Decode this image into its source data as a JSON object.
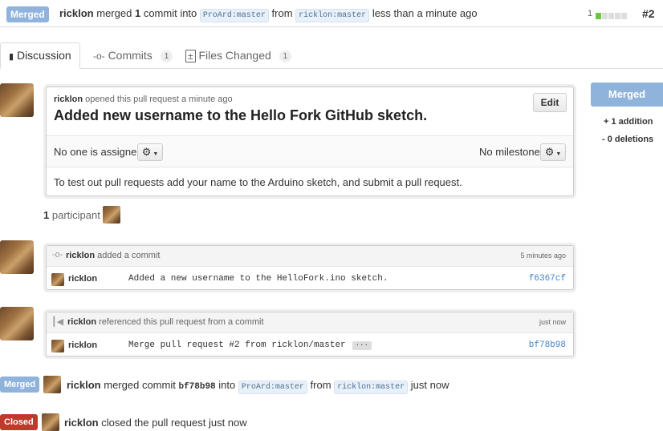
{
  "header": {
    "state": "Merged",
    "user": "ricklon",
    "merged_text": "merged",
    "commit_count": "1",
    "commit_suffix": "commit into",
    "base_ref": "ProArd:master",
    "from": "from",
    "head_ref": "ricklon:master",
    "time": "less than a minute ago",
    "diff_count": "1",
    "pr_number": "#2"
  },
  "tabs": [
    {
      "label": "Discussion"
    },
    {
      "label": "Commits",
      "count": "1"
    },
    {
      "label": "Files Changed",
      "count": "1"
    }
  ],
  "pr": {
    "author": "ricklon",
    "opened": "opened this pull request a minute ago",
    "title": "Added new username to the Hello Fork GitHub sketch.",
    "edit": "Edit",
    "assignee": "No one is assigned",
    "milestone": "No milestone",
    "body": "To test out pull requests add your name to the Arduino sketch, and submit a pull request."
  },
  "sidebar": {
    "state": "Merged",
    "additions": "+ 1 addition",
    "deletions": "- 0 deletions"
  },
  "participants": {
    "count": "1",
    "label": "participant"
  },
  "commit_event": {
    "user": "ricklon",
    "action": "added a commit",
    "time": "5 minutes ago",
    "message": "Added a new username to the HelloFork.ino sketch.",
    "sha": "f6367cf"
  },
  "ref_event": {
    "user": "ricklon",
    "action": "referenced this pull request from a commit",
    "time": "just now",
    "message": "Merge pull request #2 from ricklon/master",
    "dots": "···",
    "sha": "bf78b98"
  },
  "merge_event": {
    "state": "Merged",
    "user": "ricklon",
    "action": "merged commit",
    "sha": "bf78b98",
    "into": "into",
    "base_ref": "ProArd:master",
    "from": "from",
    "head_ref": "ricklon:master",
    "time": "just now"
  },
  "close_event": {
    "state": "Closed",
    "user": "ricklon",
    "action": "closed the pull request just now"
  },
  "colors": {
    "merged": "#8fb3db",
    "closed": "#c0392b",
    "addition": "#6cc644",
    "link": "#4183c4"
  }
}
